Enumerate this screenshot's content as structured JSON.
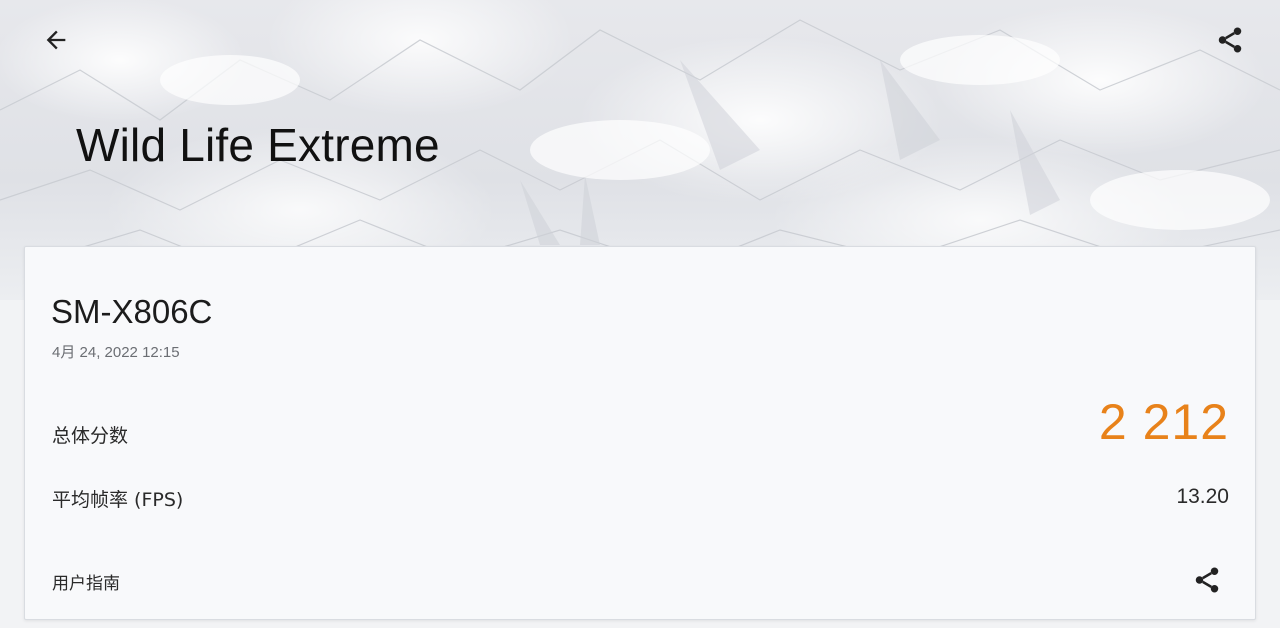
{
  "header": {
    "title": "Wild Life Extreme",
    "back_icon": "arrow-left-icon",
    "share_icon": "share-icon"
  },
  "result": {
    "device": "SM-X806C",
    "timestamp": "4月 24, 2022 12:15",
    "overall_label": "总体分数",
    "overall_score": "2 212",
    "fps_label": "平均帧率 (FPS)",
    "fps_value": "13.20",
    "guide_label": "用户指南",
    "guide_share_icon": "share-icon"
  },
  "colors": {
    "score": "#e8821a",
    "text": "#1c1c1c",
    "card_bg": "#f8f9fb"
  }
}
